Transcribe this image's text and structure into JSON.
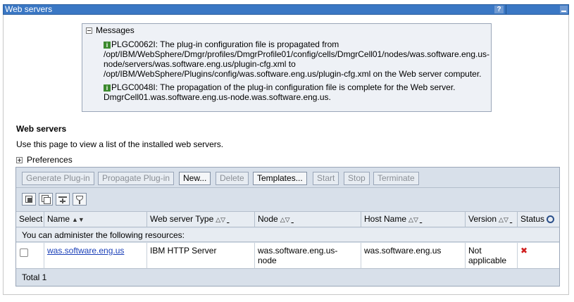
{
  "window": {
    "title": "Web servers",
    "help_label": "?"
  },
  "messages": {
    "header": "Messages",
    "items": [
      {
        "line1": "PLGC0062I: The plug-in configuration file is propagated from",
        "line2": "/opt/IBM/WebSphere/Dmgr/profiles/DmgrProfile01/config/cells/DmgrCell01/nodes/was.software.eng.us-",
        "line3": "node/servers/was.software.eng.us/plugin-cfg.xml to",
        "line4": "/opt/IBM/WebSphere/Plugins/config/was.software.eng.us/plugin-cfg.xml on the Web server computer."
      },
      {
        "line1": "PLGC0048I: The propagation of the plug-in configuration file is complete for the Web server.",
        "line2": "DmgrCell01.was.software.eng.us-node.was.software.eng.us."
      }
    ]
  },
  "section": {
    "title": "Web servers",
    "description": "Use this page to view a list of the installed web servers.",
    "preferences": "Preferences"
  },
  "toolbar": {
    "generate": "Generate Plug-in",
    "propagate": "Propagate Plug-in",
    "new": "New...",
    "delete": "Delete",
    "templates": "Templates...",
    "start": "Start",
    "stop": "Stop",
    "terminate": "Terminate"
  },
  "table": {
    "columns": {
      "select": "Select",
      "name": "Name",
      "type": "Web server Type",
      "node": "Node",
      "host": "Host Name",
      "version": "Version",
      "status": "Status"
    },
    "resources_label": "You can administer the following resources:",
    "rows": [
      {
        "name": "was.software.eng.us",
        "type": "IBM HTTP Server",
        "node_line1": "was.software.eng.us-",
        "node_line2": "node",
        "host": "was.software.eng.us",
        "version_line1": "Not",
        "version_line2": "applicable",
        "status": "stopped"
      }
    ],
    "total": "Total 1"
  },
  "colors": {
    "titlebar": "#3a77c4",
    "table_bg": "#d8e0ea",
    "link": "#1a3fb8",
    "status_stopped": "#d02020"
  }
}
